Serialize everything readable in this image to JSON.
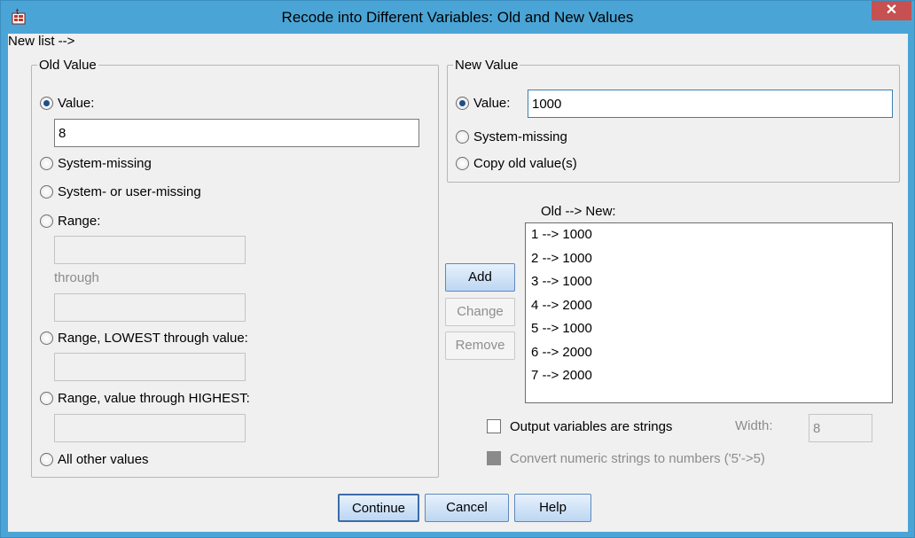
{
  "window": {
    "title": "Recode into Different Variables: Old and New Values",
    "close_glyph": "✕"
  },
  "old_value": {
    "legend": "Old Value",
    "value_label": "Value:",
    "value_input": "8",
    "system_missing_label": "System-missing",
    "system_or_user_missing_label": "System- or user-missing",
    "range_label": "Range:",
    "through_label": "through",
    "range_lowest_label": "Range, LOWEST through value:",
    "range_highest_label": "Range, value through HIGHEST:",
    "all_other_label": "All other values"
  },
  "new_value": {
    "legend": "New Value",
    "value_label": "Value:",
    "value_input": "1000",
    "system_missing_label": "System-missing",
    "copy_old_label": "Copy old value(s)"
  },
  "mapping": {
    "header": "Old --> New:",
    "items": [
      "1 --> 1000",
      "2 --> 1000",
      "3 --> 1000",
      "4 --> 2000",
      "5 --> 1000",
      "6 --> 2000",
      "7 --> 2000"
    ]
  },
  "buttons": {
    "add": "Add",
    "change": "Change",
    "remove": "Remove",
    "continue": "Continue",
    "cancel": "Cancel",
    "help": "Help"
  },
  "options": {
    "output_strings_label": "Output variables are strings",
    "width_label": "Width:",
    "width_value": "8",
    "convert_label": "Convert numeric strings to numbers ('5'->5)"
  },
  "colors": {
    "titlebar": "#4aa5d6",
    "close_button": "#c75050"
  }
}
